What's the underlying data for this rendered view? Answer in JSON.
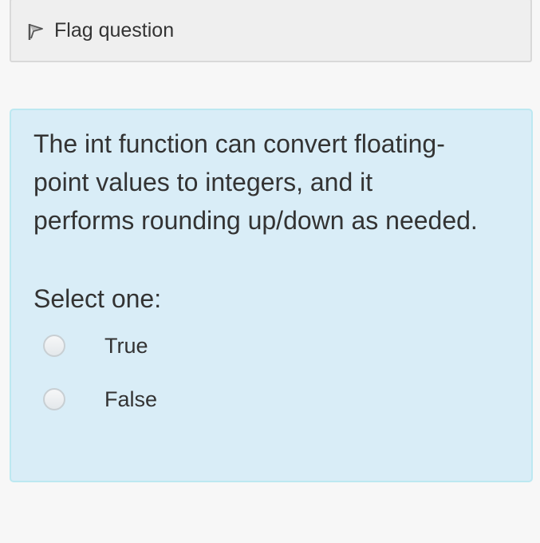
{
  "flag": {
    "label": "Flag question",
    "icon": "flag-outline-icon"
  },
  "question": {
    "text": "The int function can convert floating-point values to integers, and it performs rounding up/down as needed.",
    "prompt": "Select one:",
    "options": [
      {
        "label": "True",
        "selected": false
      },
      {
        "label": "False",
        "selected": false
      }
    ]
  },
  "colors": {
    "page_background": "#f7f7f7",
    "flag_background": "#efefef",
    "question_background": "#d9edf7",
    "question_border": "#bce8f1",
    "text": "#333333"
  }
}
